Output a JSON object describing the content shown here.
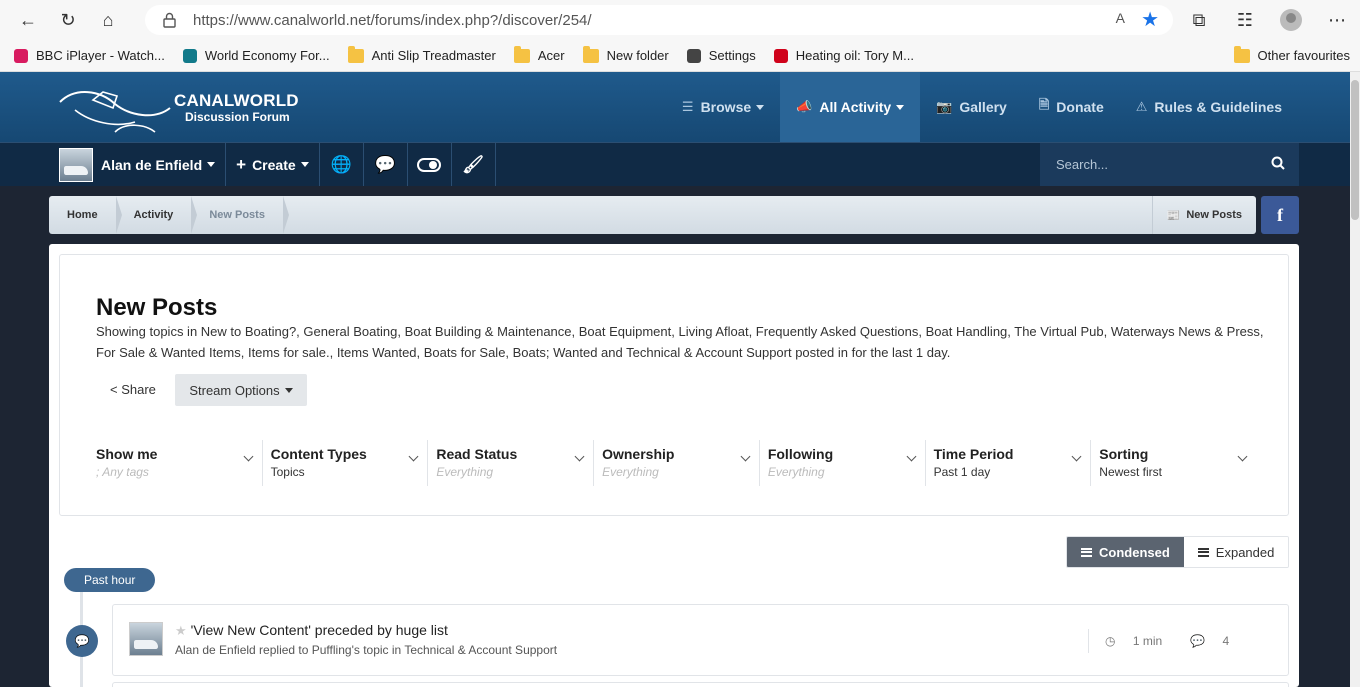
{
  "browser": {
    "url": "https://www.canalworld.net/forums/index.php?/discover/254/",
    "read_aloud": "A",
    "bookmarks": [
      {
        "label": "BBC iPlayer - Watch...",
        "icon": "iplayer-icon",
        "color": "#d81b60"
      },
      {
        "label": "World Economy For...",
        "icon": "ft-icon",
        "color": "#127a8a"
      },
      {
        "label": "Anti Slip Treadmaster",
        "icon": "folder-icon",
        "color": "#f5c243"
      },
      {
        "label": "Acer",
        "icon": "folder-icon",
        "color": "#f5c243"
      },
      {
        "label": "New folder",
        "icon": "folder-icon",
        "color": "#f5c243"
      },
      {
        "label": "Settings",
        "icon": "gear-icon",
        "color": "#444444"
      },
      {
        "label": "Heating oil: Tory M...",
        "icon": "news-icon",
        "color": "#d0021b"
      }
    ],
    "other_favourites": "Other favourites"
  },
  "site": {
    "logo_title": "CANALWORLD",
    "logo_sub": "Discussion Forum",
    "nav": [
      {
        "label": "Browse",
        "icon": "list-icon"
      },
      {
        "label": "All Activity",
        "icon": "megaphone-icon"
      },
      {
        "label": "Gallery",
        "icon": "camera-icon"
      },
      {
        "label": "Donate",
        "icon": "document-icon"
      },
      {
        "label": "Rules & Guidelines",
        "icon": "warning-icon"
      }
    ],
    "user_name": "Alan de Enfield",
    "create_label": "Create",
    "search_placeholder": "Search..."
  },
  "breadcrumb": {
    "items": [
      "Home",
      "Activity",
      "New Posts"
    ],
    "right_label": "New Posts",
    "facebook": "f"
  },
  "page": {
    "title": "New Posts",
    "description": "Showing topics in New to Boating?, General Boating, Boat Building & Maintenance, Boat Equipment, Living Afloat, Frequently Asked Questions, Boat Handling, The Virtual Pub, Waterways News & Press, For Sale & Wanted Items, Items for sale., Items Wanted, Boats for Sale, Boats; Wanted and Technical & Account Support posted in for the last 1 day.",
    "share_label": "Share",
    "stream_options_label": "Stream Options",
    "filters": [
      {
        "label": "Show me",
        "value": "; Any tags",
        "muted": true
      },
      {
        "label": "Content Types",
        "value": "Topics",
        "muted": false
      },
      {
        "label": "Read Status",
        "value": "Everything",
        "muted": true
      },
      {
        "label": "Ownership",
        "value": "Everything",
        "muted": true
      },
      {
        "label": "Following",
        "value": "Everything",
        "muted": true
      },
      {
        "label": "Time Period",
        "value": "Past 1 day",
        "muted": false
      },
      {
        "label": "Sorting",
        "value": "Newest first",
        "muted": false
      }
    ],
    "view_condensed": "Condensed",
    "view_expanded": "Expanded",
    "time_group": "Past hour",
    "stream": [
      {
        "title": "'View New Content' preceded by huge list",
        "meta": "Alan de Enfield replied to Puffling's topic in Technical & Account Support",
        "time": "1 min",
        "replies": "4"
      }
    ]
  },
  "colors": {
    "header_blue": "#1f5a8c",
    "user_bar": "#102a45",
    "accent": "#3e6790",
    "facebook": "#3b5998"
  }
}
